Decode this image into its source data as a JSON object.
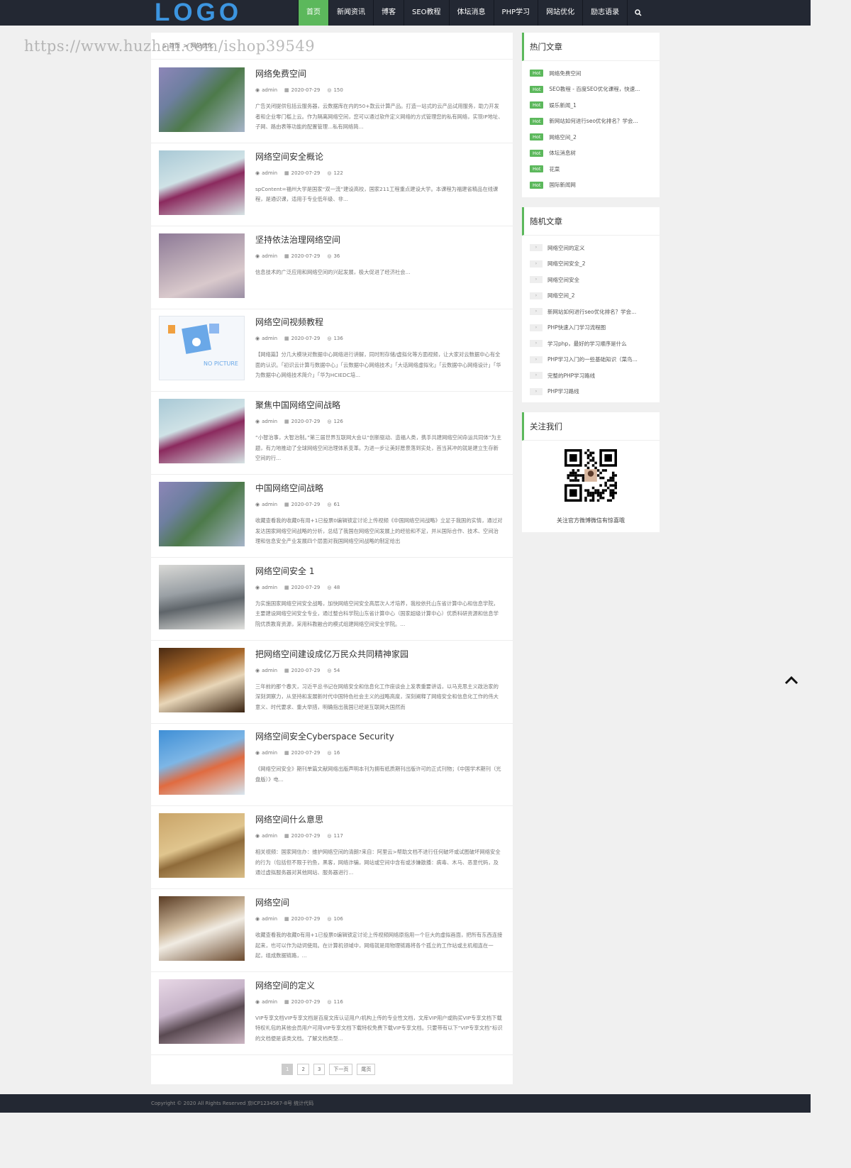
{
  "header": {
    "logo": "LOGO",
    "nav": [
      "首页",
      "新闻资讯",
      "博客",
      "SEO教程",
      "体坛消息",
      "PHP学习",
      "网站优化",
      "励志语录"
    ],
    "search_icon": "search-icon"
  },
  "watermark": "https://www.huzhan.com/ishop39549",
  "breadcrumb": {
    "home": "首页",
    "sep": ">",
    "current": "网站优化"
  },
  "posts": [
    {
      "title": "网络免费空间",
      "author": "admin",
      "date": "2020-07-29",
      "views": "150",
      "excerpt": "广告关闭提供包括云服务器，云数据库在内的50+款云计算产品。打造一站式的云产品试用服务，助力开发者和企业零门槛上云。作为隔离网络空间，您可以通过软件定义网络的方式管理您的私有网络，实现IP地址、子网、路由表等功能的配置管理...私有网络简..."
    },
    {
      "title": "网络空间安全概论",
      "author": "admin",
      "date": "2020-07-29",
      "views": "122",
      "excerpt": "spContent=福州大学是国家“双一流”建设高校，国家211工程重点建设大学。本课程为福建省精品在线课程，是通识课，适用于专业低年级、非..."
    },
    {
      "title": "坚持依法治理网络空间",
      "author": "admin",
      "date": "2020-07-29",
      "views": "36",
      "excerpt": "信息技术的广泛应用和网络空间的兴起发展，极大促进了经济社会..."
    },
    {
      "title": "网络空间视频教程",
      "author": "admin",
      "date": "2020-07-29",
      "views": "136",
      "excerpt": "【网络篇】分几大模块对数据中心网络进行讲解，同时附存储/虚拟化等方面视频，让大家对云数据中心有全面的认识。「初识云计算与数据中心」「云数据中心网络技术」「大话网络虚拟化」「云数据中心网络设计」「华为数据中心网络技术简介」「华为HCIEDC培..."
    },
    {
      "title": "聚焦中国网络空间战略",
      "author": "admin",
      "date": "2020-07-29",
      "views": "126",
      "excerpt": "“小智治事，大智治制。”第三届世界互联网大会以“创新驱动、造福人类，携手共建网络空间命运共同体”为主题，有力地推动了全球网络空间治理体系变革。为进一步让美好愿景落到实处，首当其冲的就是建立生存新空间的行..."
    },
    {
      "title": "中国网络空间战略",
      "author": "admin",
      "date": "2020-07-29",
      "views": "61",
      "excerpt": "收藏查看我的收藏0有用+1已投票0编辑锁定讨论上传视频《中国网络空间战略》立足于我国的实情，通过对发达国家网络空间战略的分析，总结了我国在网络空间发展上的经验和不足，并从国际合作、技术、空间治理和信息安全产业发展四个层面对我国网络空间战略的制定给出"
    },
    {
      "title": "网络空间安全 1",
      "author": "admin",
      "date": "2020-07-29",
      "views": "48",
      "excerpt": "为实施国家网络空间安全战略，加快网络空间安全高层次人才培养，我校依托山东省计算中心和信息学院，主要建设网络空间安全专业，通过整合科学院山东省计算中心（国家超级计算中心）优质科研资源和信息学院优质教育资源，采用科教融合的模式组建网络空间安全学院。..."
    },
    {
      "title": "把网络空间建设成亿万民众共同精神家园",
      "author": "admin",
      "date": "2020-07-29",
      "views": "54",
      "excerpt": "三年前的那个春天，习近平总书记在网络安全和信息化工作座谈会上发表重要讲话，以马克思主义政治家的深刻洞察力，从坚持和发展新时代中国特色社会主义的战略高度，深刻阐释了网络安全和信息化工作的伟大意义、时代要求、重大举措，明确指出我国已经是互联网大国然而"
    },
    {
      "title": "网络空间安全Cyberspace Security",
      "author": "admin",
      "date": "2020-07-29",
      "views": "16",
      "excerpt": "《网络空间安全》期刊单篇文献网络出版声明本刊为拥有纸质期刊出版许可的正式刊物；《中国学术期刊（光盘版）》电..."
    },
    {
      "title": "网络空间什么意思",
      "author": "admin",
      "date": "2020-07-29",
      "views": "117",
      "excerpt": "相关视频：国家网信办：维护网络空间的清朗?来自：阿里云>帮助文档不进行任何破坏或试图破坏网络安全的行为（包括但不限于钓鱼，黑客，网络诈骗，网站或空间中含有或涉嫌散播：病毒、木马、恶意代码，及通过虚拟服务器对其他网站、服务器进行..."
    },
    {
      "title": "网络空间",
      "author": "admin",
      "date": "2020-07-29",
      "views": "106",
      "excerpt": "收藏查看我的收藏0有用+1已投票0编辑锁定讨论上传视频网络原指用一个巨大的虚拟画面，把所有东西连接起来，也可以作为动词使用。在计算机领域中，网络就是用物理链路将各个孤立的工作站或主机相连在一起，组成数据链路，..."
    },
    {
      "title": "网络空间的定义",
      "author": "admin",
      "date": "2020-07-29",
      "views": "116",
      "excerpt": "VIP专享文档VIP专享文档是百度文库认证用户/机构上传的专业性文档，文库VIP用户或购买VIP专享文档下载特权礼包的其他会员用户可用VIP专享文档下载特权免费下载VIP专享文档。只要带有以下“VIP专享文档”标识的文档便是该类文档。了解文档类型..."
    }
  ],
  "pagination": [
    "1",
    "2",
    "3",
    "下一页",
    "尾页"
  ],
  "hot": {
    "title": "热门文章",
    "badge": "Hot",
    "items": [
      "网络免费空间",
      "SEO教程 - 百度SEO优化课程，快速...",
      "娱乐新闻_1",
      "新网站如何进行seo优化排名？学会...",
      "网络空间_2",
      "体坛消息树",
      "花菜",
      "国际新闻网"
    ]
  },
  "random": {
    "title": "随机文章",
    "items": [
      "网络空间的定义",
      "网络空间安全_2",
      "网络空间安全",
      "网络空间_2",
      "新网站如何进行seo优化排名？学会...",
      "PHP快速入门学习流程图",
      "学习php，最好的学习顺序是什么",
      "PHP学习入门的一些基础知识（菜鸟...",
      "完整的PHP学习路线",
      "PHP学习路线"
    ]
  },
  "follow": {
    "title": "关注我们",
    "caption": "关注官方微博微信有惊喜哦"
  },
  "footer": "Copyright © 2020 All Rights Reserved 京ICP1234567-8号 统计代码"
}
